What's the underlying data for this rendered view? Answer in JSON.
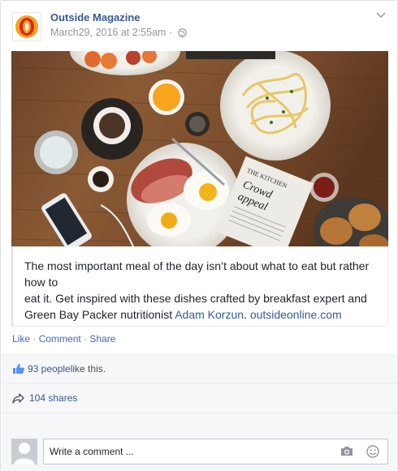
{
  "post": {
    "page_name": "Outside Magazine",
    "timestamp": "March29, 2016 at 2:55am",
    "privacy_sep": "·",
    "photo_text": {
      "headline_small": "THE KITCHEN",
      "headline_big_1": "Crowd",
      "headline_big_2": "appeal"
    },
    "caption": {
      "line1": "The most important meal of the day isn’t about what to eat but rather",
      "line2": "how to",
      "line3": "eat it. Get inspired with these dishes crafted by breakfast expert and",
      "line4_prefix": "Green Bay Packer nutritionist ",
      "mention": "Adam Korzun",
      "after_mention": ". ",
      "link": "outsideonline.com"
    }
  },
  "actions": {
    "like": "Like",
    "comment": "Comment",
    "share": "Share",
    "sep": " · "
  },
  "stats": {
    "likes_link": "93 people",
    "likes_suffix": " like this.",
    "shares": "104 shares"
  },
  "composer": {
    "placeholder": "Write a comment ..."
  },
  "colors": {
    "link": "#365899",
    "accent": "#4267b2",
    "logo_orange": "#f5a21b",
    "logo_red": "#d9232a"
  }
}
